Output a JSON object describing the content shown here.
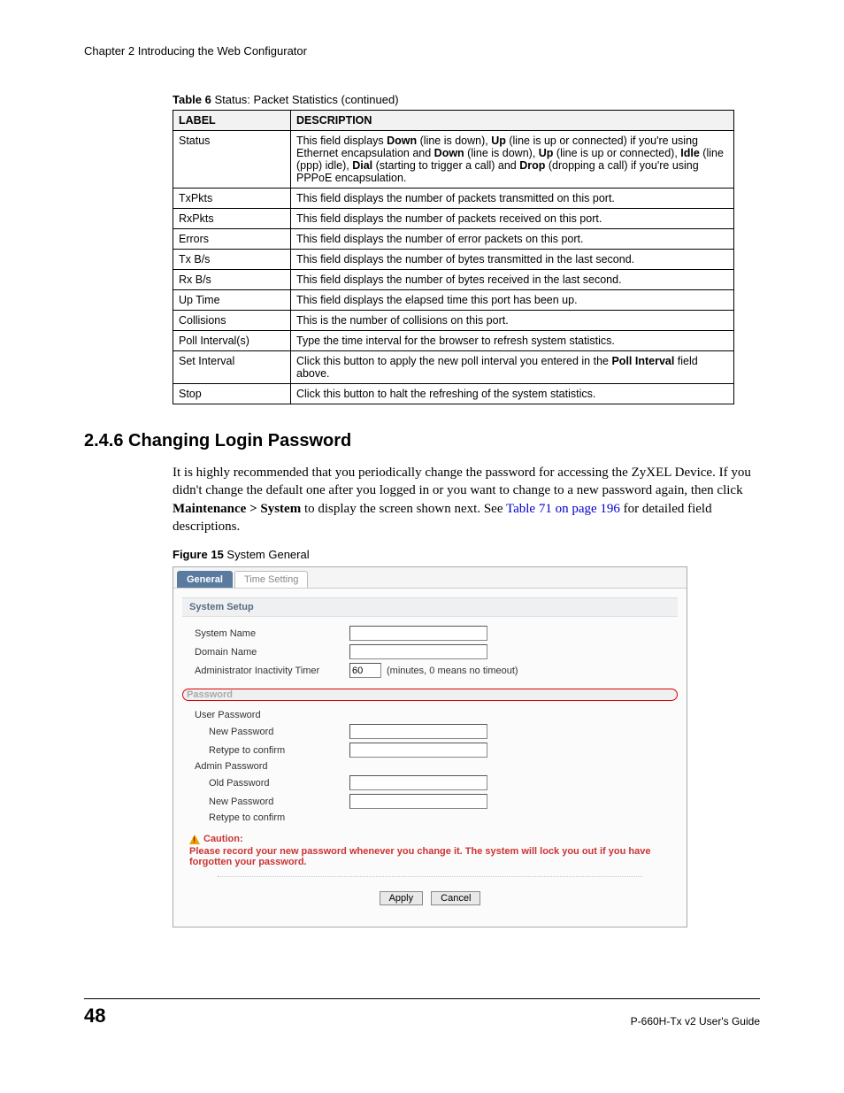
{
  "header": "Chapter 2 Introducing the Web Configurator",
  "table_caption_bold": "Table 6",
  "table_caption_rest": "   Status: Packet Statistics (continued)",
  "th_label": "LABEL",
  "th_desc": "DESCRIPTION",
  "rows": [
    {
      "label": "Status",
      "desc_pre": "This field displays ",
      "b1": "Down",
      "t1": " (line is down), ",
      "b2": "Up",
      "t2": " (line is up or connected) if you're using Ethernet encapsulation and ",
      "b3": "Down",
      "t3": " (line is down), ",
      "b4": "Up",
      "t4": " (line is up or connected), ",
      "b5": "Idle",
      "t5": " (line (ppp) idle), ",
      "b6": "Dial",
      "t6": " (starting to trigger a call) and ",
      "b7": "Drop",
      "t7": " (dropping a call) if you're using PPPoE encapsulation."
    },
    {
      "label": "TxPkts",
      "desc": "This field displays the number of packets transmitted on this port."
    },
    {
      "label": "RxPkts",
      "desc": "This field displays the number of packets received on this port."
    },
    {
      "label": "Errors",
      "desc": "This field displays the number of error packets on this port."
    },
    {
      "label": "Tx B/s",
      "desc": "This field displays the number of bytes transmitted in the last second."
    },
    {
      "label": "Rx B/s",
      "desc": "This field displays the number of bytes received in the last second."
    },
    {
      "label": "Up Time",
      "desc": "This field displays the elapsed time this port has been up."
    },
    {
      "label": "Collisions",
      "desc": "This is the number of collisions on this port."
    },
    {
      "label": "Poll Interval(s)",
      "desc": "Type the time interval for the browser to refresh system statistics."
    },
    {
      "label": "Set Interval",
      "desc_pre": "Click this button to apply the new poll interval you entered in the ",
      "b1": "Poll Interval",
      "t1": " field above."
    },
    {
      "label": "Stop",
      "desc": "Click this button to halt the refreshing of the system statistics."
    }
  ],
  "section_heading": "2.4.6  Changing Login Password",
  "para_pre": "It is highly recommended that you periodically change the password for accessing the ZyXEL Device. If you didn't change the default one after you logged in or you want to change to a new password again, then click ",
  "para_bold": "Maintenance > System",
  "para_mid": " to display the screen shown next. See ",
  "para_link": "Table 71 on page 196",
  "para_post": " for detailed field descriptions.",
  "figure_caption_bold": "Figure 15",
  "figure_caption_rest": "   System General",
  "fig": {
    "tab_general": "General",
    "tab_time": "Time Setting",
    "sec_system": "System Setup",
    "lbl_sysname": "System Name",
    "lbl_domain": "Domain Name",
    "lbl_admin_timer": "Administrator Inactivity Timer",
    "val_timer": "60",
    "hint_timer": "(minutes, 0 means no timeout)",
    "sec_password": "Password",
    "lbl_userpw": "User Password",
    "lbl_newpw": "New Password",
    "lbl_retype": "Retype to confirm",
    "lbl_adminpw": "Admin Password",
    "lbl_oldpw": "Old Password",
    "caution_title": "Caution:",
    "caution_text": "Please record your new password whenever you change it. The system will lock you out if you have forgotten your password.",
    "btn_apply": "Apply",
    "btn_cancel": "Cancel"
  },
  "page_no": "48",
  "guide": "P-660H-Tx v2 User's Guide"
}
